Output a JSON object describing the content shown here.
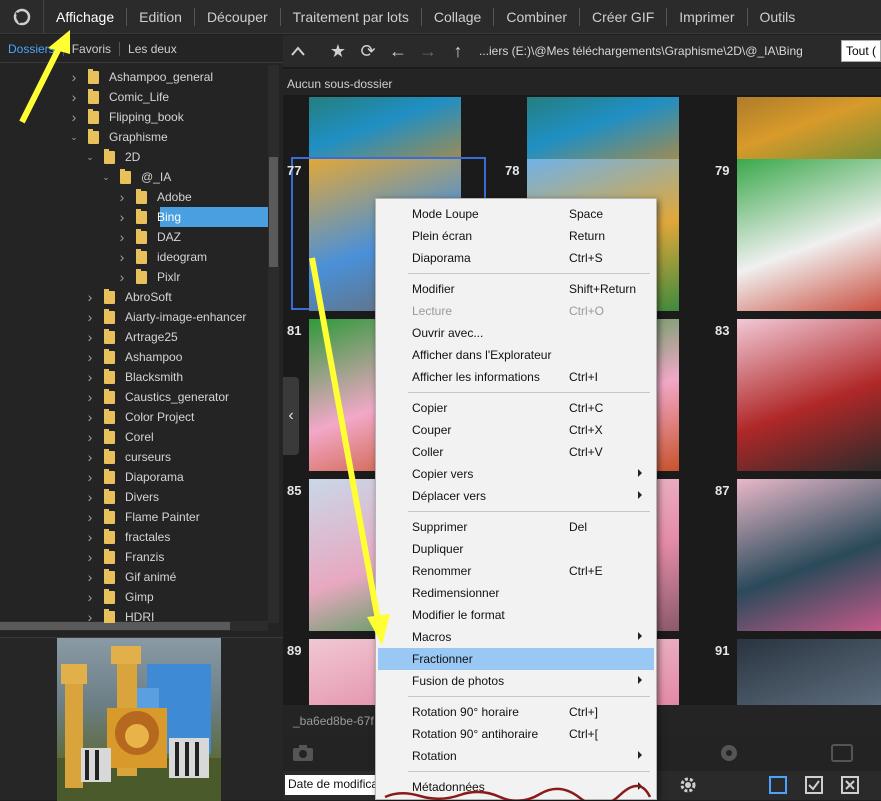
{
  "menubar": {
    "items": [
      "Affichage",
      "Edition",
      "Découper",
      "Traitement par lots",
      "Collage",
      "Combiner",
      "Créer GIF",
      "Imprimer",
      "Outils"
    ],
    "active_index": 0
  },
  "left_tabs": [
    "Dossiers",
    "Favoris",
    "Les deux"
  ],
  "tree": [
    {
      "label": "Ashampoo_general",
      "depth": 0,
      "expanded": false
    },
    {
      "label": "Comic_Life",
      "depth": 0,
      "expanded": false
    },
    {
      "label": "Flipping_book",
      "depth": 0,
      "expanded": false
    },
    {
      "label": "Graphisme",
      "depth": 0,
      "expanded": true
    },
    {
      "label": "2D",
      "depth": 1,
      "expanded": true
    },
    {
      "label": "@_IA",
      "depth": 2,
      "expanded": true
    },
    {
      "label": "Adobe",
      "depth": 3,
      "expanded": false
    },
    {
      "label": "Bing",
      "depth": 3,
      "expanded": false,
      "selected": true
    },
    {
      "label": "DAZ",
      "depth": 3,
      "expanded": false
    },
    {
      "label": "ideogram",
      "depth": 3,
      "expanded": false
    },
    {
      "label": "Pixlr",
      "depth": 3,
      "expanded": false
    },
    {
      "label": "AbroSoft",
      "depth": 1,
      "expanded": false
    },
    {
      "label": "Aiarty-image-enhancer",
      "depth": 1,
      "expanded": false
    },
    {
      "label": "Artrage25",
      "depth": 1,
      "expanded": false
    },
    {
      "label": "Ashampoo",
      "depth": 1,
      "expanded": false
    },
    {
      "label": "Blacksmith",
      "depth": 1,
      "expanded": false
    },
    {
      "label": "Caustics_generator",
      "depth": 1,
      "expanded": false
    },
    {
      "label": "Color Project",
      "depth": 1,
      "expanded": false
    },
    {
      "label": "Corel",
      "depth": 1,
      "expanded": false
    },
    {
      "label": "curseurs",
      "depth": 1,
      "expanded": false
    },
    {
      "label": "Diaporama",
      "depth": 1,
      "expanded": false
    },
    {
      "label": "Divers",
      "depth": 1,
      "expanded": false
    },
    {
      "label": "Flame Painter",
      "depth": 1,
      "expanded": false
    },
    {
      "label": "fractales",
      "depth": 1,
      "expanded": false
    },
    {
      "label": "Franzis",
      "depth": 1,
      "expanded": false
    },
    {
      "label": "Gif animé",
      "depth": 1,
      "expanded": false
    },
    {
      "label": "Gimp",
      "depth": 1,
      "expanded": false
    },
    {
      "label": "HDRI",
      "depth": 1,
      "expanded": false
    }
  ],
  "nav": {
    "path": "...iers (E:)\\@Mes téléchargements\\Graphisme\\2D\\@_IA\\Bing",
    "filter": "Tout (",
    "subfolder_text": "Aucun sous-dossier"
  },
  "thumbnails": [
    {
      "num": "",
      "row": 0,
      "col": 0,
      "theme": "lego-river"
    },
    {
      "num": "",
      "row": 0,
      "col": 1,
      "theme": "lego-river"
    },
    {
      "num": "",
      "row": 0,
      "col": 2,
      "theme": "lego-lion"
    },
    {
      "num": "77",
      "row": 1,
      "col": 0,
      "theme": "lego-giraffe",
      "selected": true
    },
    {
      "num": "78",
      "row": 1,
      "col": 1,
      "theme": "lego-sky"
    },
    {
      "num": "79",
      "row": 1,
      "col": 2,
      "theme": "lego-farm"
    },
    {
      "num": "81",
      "row": 2,
      "col": 0,
      "theme": "lego-blossom"
    },
    {
      "num": "",
      "row": 2,
      "col": 1,
      "theme": "lego-blossom"
    },
    {
      "num": "83",
      "row": 2,
      "col": 2,
      "theme": "pagoda"
    },
    {
      "num": "85",
      "row": 3,
      "col": 0,
      "theme": "lego-tower"
    },
    {
      "num": "",
      "row": 3,
      "col": 1,
      "theme": "pink"
    },
    {
      "num": "87",
      "row": 3,
      "col": 2,
      "theme": "bird"
    },
    {
      "num": "89",
      "row": 4,
      "col": 0,
      "theme": "pink"
    },
    {
      "num": "",
      "row": 4,
      "col": 1,
      "theme": "pink"
    },
    {
      "num": "91",
      "row": 4,
      "col": 2,
      "theme": "rainbow"
    }
  ],
  "filename": "_ba6ed8be-67f",
  "sort": "Date de modifica",
  "context_menu": {
    "groups": [
      [
        {
          "label": "Mode Loupe",
          "shortcut": "Space"
        },
        {
          "label": "Plein écran",
          "shortcut": "Return"
        },
        {
          "label": "Diaporama",
          "shortcut": "Ctrl+S"
        }
      ],
      [
        {
          "label": "Modifier",
          "shortcut": "Shift+Return"
        },
        {
          "label": "Lecture",
          "shortcut": "Ctrl+O",
          "disabled": true
        },
        {
          "label": "Ouvrir avec...",
          "shortcut": ""
        },
        {
          "label": "Afficher dans l'Explorateur",
          "shortcut": ""
        },
        {
          "label": "Afficher les informations",
          "shortcut": "Ctrl+I"
        }
      ],
      [
        {
          "label": "Copier",
          "shortcut": "Ctrl+C"
        },
        {
          "label": "Couper",
          "shortcut": "Ctrl+X"
        },
        {
          "label": "Coller",
          "shortcut": "Ctrl+V"
        },
        {
          "label": "Copier vers",
          "shortcut": "",
          "submenu": true
        },
        {
          "label": "Déplacer vers",
          "shortcut": "",
          "submenu": true
        }
      ],
      [
        {
          "label": "Supprimer",
          "shortcut": "Del"
        },
        {
          "label": "Dupliquer",
          "shortcut": ""
        },
        {
          "label": "Renommer",
          "shortcut": "Ctrl+E"
        },
        {
          "label": "Redimensionner",
          "shortcut": ""
        },
        {
          "label": "Modifier le format",
          "shortcut": ""
        },
        {
          "label": "Macros",
          "shortcut": "",
          "submenu": true
        },
        {
          "label": "Fractionner",
          "shortcut": "",
          "highlight": true
        },
        {
          "label": "Fusion de photos",
          "shortcut": "",
          "submenu": true
        }
      ],
      [
        {
          "label": "Rotation 90° horaire",
          "shortcut": "Ctrl+]"
        },
        {
          "label": "Rotation 90° antihoraire",
          "shortcut": "Ctrl+["
        },
        {
          "label": "Rotation",
          "shortcut": "",
          "submenu": true
        }
      ],
      [
        {
          "label": "Métadonnées",
          "shortcut": "",
          "submenu": true
        }
      ]
    ]
  },
  "colors": {
    "accent": "#4aa3ff",
    "selection": "#4a9fe0",
    "menu_highlight": "#9ac8f5",
    "annotation_arrow": "#ffff33"
  }
}
